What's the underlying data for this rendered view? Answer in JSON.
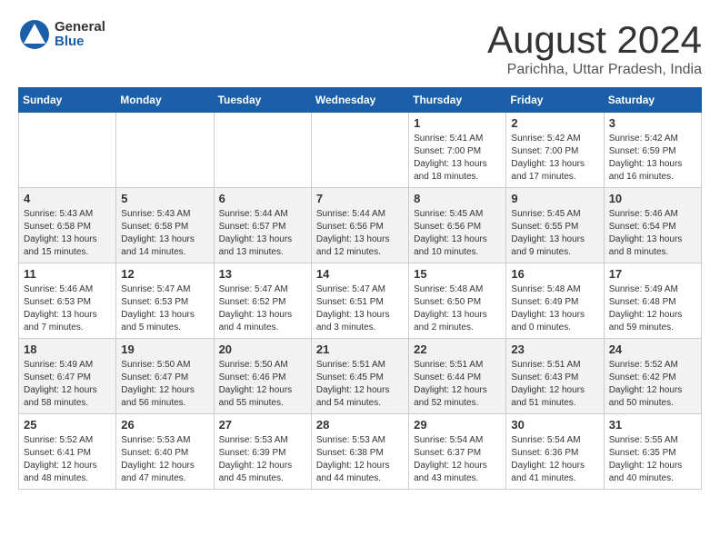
{
  "header": {
    "logo_general": "General",
    "logo_blue": "Blue",
    "month": "August 2024",
    "location": "Parichha, Uttar Pradesh, India"
  },
  "weekdays": [
    "Sunday",
    "Monday",
    "Tuesday",
    "Wednesday",
    "Thursday",
    "Friday",
    "Saturday"
  ],
  "weeks": [
    [
      {
        "day": "",
        "info": ""
      },
      {
        "day": "",
        "info": ""
      },
      {
        "day": "",
        "info": ""
      },
      {
        "day": "",
        "info": ""
      },
      {
        "day": "1",
        "info": "Sunrise: 5:41 AM\nSunset: 7:00 PM\nDaylight: 13 hours\nand 18 minutes."
      },
      {
        "day": "2",
        "info": "Sunrise: 5:42 AM\nSunset: 7:00 PM\nDaylight: 13 hours\nand 17 minutes."
      },
      {
        "day": "3",
        "info": "Sunrise: 5:42 AM\nSunset: 6:59 PM\nDaylight: 13 hours\nand 16 minutes."
      }
    ],
    [
      {
        "day": "4",
        "info": "Sunrise: 5:43 AM\nSunset: 6:58 PM\nDaylight: 13 hours\nand 15 minutes."
      },
      {
        "day": "5",
        "info": "Sunrise: 5:43 AM\nSunset: 6:58 PM\nDaylight: 13 hours\nand 14 minutes."
      },
      {
        "day": "6",
        "info": "Sunrise: 5:44 AM\nSunset: 6:57 PM\nDaylight: 13 hours\nand 13 minutes."
      },
      {
        "day": "7",
        "info": "Sunrise: 5:44 AM\nSunset: 6:56 PM\nDaylight: 13 hours\nand 12 minutes."
      },
      {
        "day": "8",
        "info": "Sunrise: 5:45 AM\nSunset: 6:56 PM\nDaylight: 13 hours\nand 10 minutes."
      },
      {
        "day": "9",
        "info": "Sunrise: 5:45 AM\nSunset: 6:55 PM\nDaylight: 13 hours\nand 9 minutes."
      },
      {
        "day": "10",
        "info": "Sunrise: 5:46 AM\nSunset: 6:54 PM\nDaylight: 13 hours\nand 8 minutes."
      }
    ],
    [
      {
        "day": "11",
        "info": "Sunrise: 5:46 AM\nSunset: 6:53 PM\nDaylight: 13 hours\nand 7 minutes."
      },
      {
        "day": "12",
        "info": "Sunrise: 5:47 AM\nSunset: 6:53 PM\nDaylight: 13 hours\nand 5 minutes."
      },
      {
        "day": "13",
        "info": "Sunrise: 5:47 AM\nSunset: 6:52 PM\nDaylight: 13 hours\nand 4 minutes."
      },
      {
        "day": "14",
        "info": "Sunrise: 5:47 AM\nSunset: 6:51 PM\nDaylight: 13 hours\nand 3 minutes."
      },
      {
        "day": "15",
        "info": "Sunrise: 5:48 AM\nSunset: 6:50 PM\nDaylight: 13 hours\nand 2 minutes."
      },
      {
        "day": "16",
        "info": "Sunrise: 5:48 AM\nSunset: 6:49 PM\nDaylight: 13 hours\nand 0 minutes."
      },
      {
        "day": "17",
        "info": "Sunrise: 5:49 AM\nSunset: 6:48 PM\nDaylight: 12 hours\nand 59 minutes."
      }
    ],
    [
      {
        "day": "18",
        "info": "Sunrise: 5:49 AM\nSunset: 6:47 PM\nDaylight: 12 hours\nand 58 minutes."
      },
      {
        "day": "19",
        "info": "Sunrise: 5:50 AM\nSunset: 6:47 PM\nDaylight: 12 hours\nand 56 minutes."
      },
      {
        "day": "20",
        "info": "Sunrise: 5:50 AM\nSunset: 6:46 PM\nDaylight: 12 hours\nand 55 minutes."
      },
      {
        "day": "21",
        "info": "Sunrise: 5:51 AM\nSunset: 6:45 PM\nDaylight: 12 hours\nand 54 minutes."
      },
      {
        "day": "22",
        "info": "Sunrise: 5:51 AM\nSunset: 6:44 PM\nDaylight: 12 hours\nand 52 minutes."
      },
      {
        "day": "23",
        "info": "Sunrise: 5:51 AM\nSunset: 6:43 PM\nDaylight: 12 hours\nand 51 minutes."
      },
      {
        "day": "24",
        "info": "Sunrise: 5:52 AM\nSunset: 6:42 PM\nDaylight: 12 hours\nand 50 minutes."
      }
    ],
    [
      {
        "day": "25",
        "info": "Sunrise: 5:52 AM\nSunset: 6:41 PM\nDaylight: 12 hours\nand 48 minutes."
      },
      {
        "day": "26",
        "info": "Sunrise: 5:53 AM\nSunset: 6:40 PM\nDaylight: 12 hours\nand 47 minutes."
      },
      {
        "day": "27",
        "info": "Sunrise: 5:53 AM\nSunset: 6:39 PM\nDaylight: 12 hours\nand 45 minutes."
      },
      {
        "day": "28",
        "info": "Sunrise: 5:53 AM\nSunset: 6:38 PM\nDaylight: 12 hours\nand 44 minutes."
      },
      {
        "day": "29",
        "info": "Sunrise: 5:54 AM\nSunset: 6:37 PM\nDaylight: 12 hours\nand 43 minutes."
      },
      {
        "day": "30",
        "info": "Sunrise: 5:54 AM\nSunset: 6:36 PM\nDaylight: 12 hours\nand 41 minutes."
      },
      {
        "day": "31",
        "info": "Sunrise: 5:55 AM\nSunset: 6:35 PM\nDaylight: 12 hours\nand 40 minutes."
      }
    ]
  ]
}
